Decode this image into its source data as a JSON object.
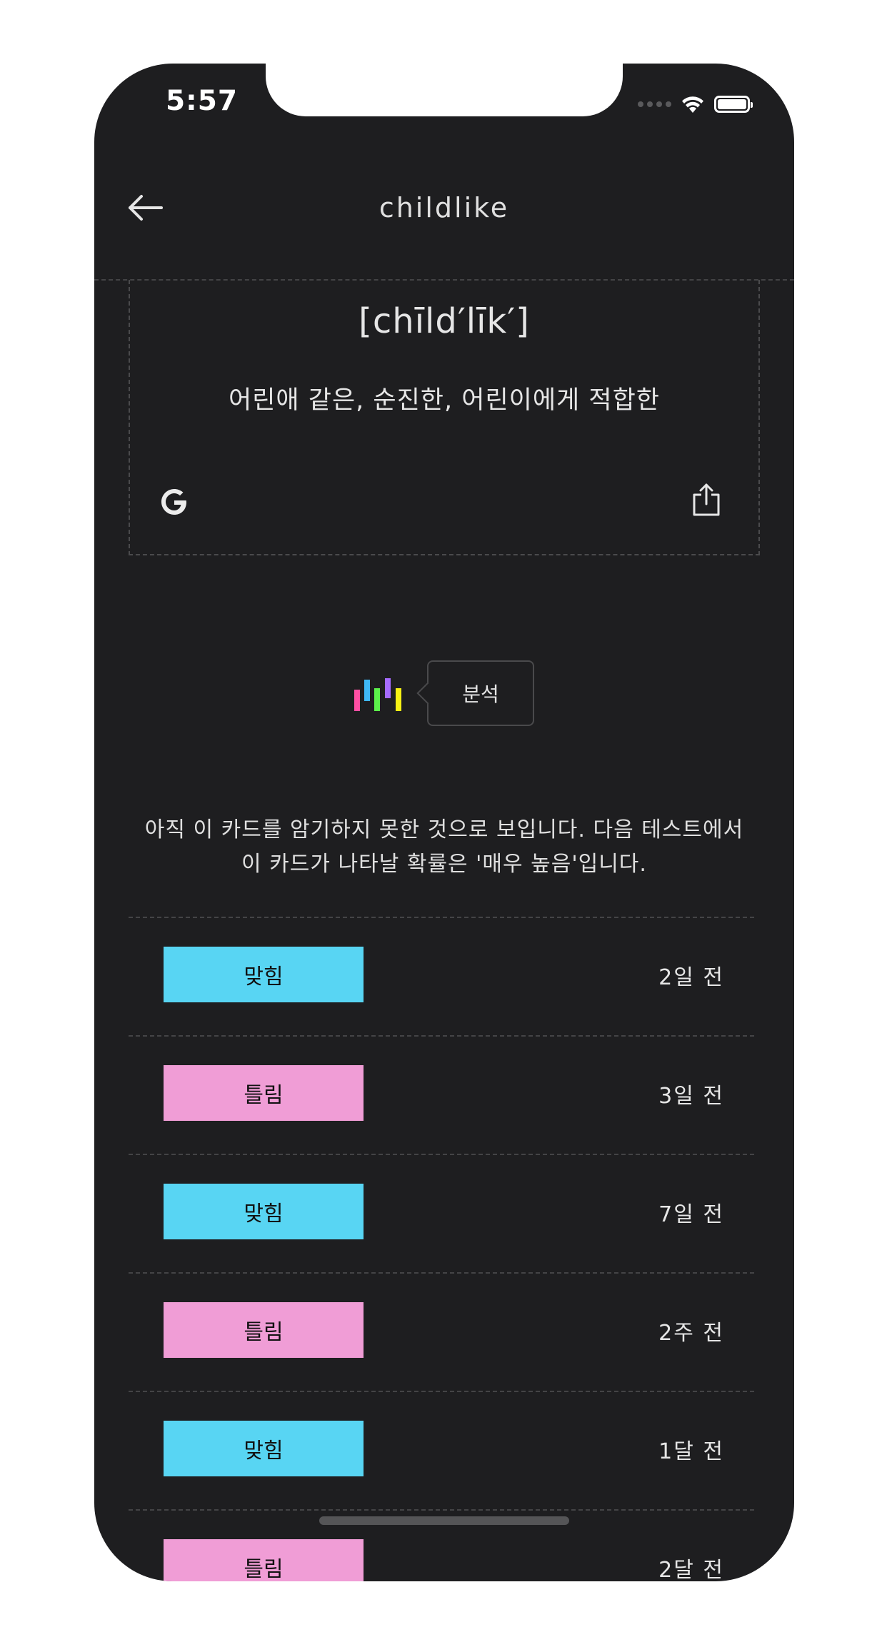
{
  "status_bar": {
    "time": "5:57"
  },
  "nav": {
    "title": "childlike",
    "back_icon": "arrow-left-icon"
  },
  "card": {
    "pronunciation": "[chīld′līk′]",
    "meaning": "어린애 같은, 순진한, 어린이에게 적합한",
    "google_icon": "google-g-icon",
    "share_icon": "share-icon"
  },
  "analysis": {
    "button_label": "분석",
    "icon": "bar-chart-icon",
    "icon_colors": [
      "#ff4fa3",
      "#3fb8f5",
      "#5cf04a",
      "#a66bff",
      "#f7f214"
    ],
    "message": "아직 이 카드를 암기하지 못한 것으로 보입니다. 다음 테스트에서 이 카드가 나타날 확률은 '매우 높음'입니다."
  },
  "colors": {
    "background": "#1e1e20",
    "correct": "#58d5f3",
    "wrong": "#f09dd6"
  },
  "history": [
    {
      "result": "맞힘",
      "status": "correct",
      "time": "2일 전"
    },
    {
      "result": "틀림",
      "status": "wrong",
      "time": "3일 전"
    },
    {
      "result": "맞힘",
      "status": "correct",
      "time": "7일 전"
    },
    {
      "result": "틀림",
      "status": "wrong",
      "time": "2주 전"
    },
    {
      "result": "맞힘",
      "status": "correct",
      "time": "1달 전"
    },
    {
      "result": "틀림",
      "status": "wrong",
      "time": "2달 전"
    }
  ]
}
